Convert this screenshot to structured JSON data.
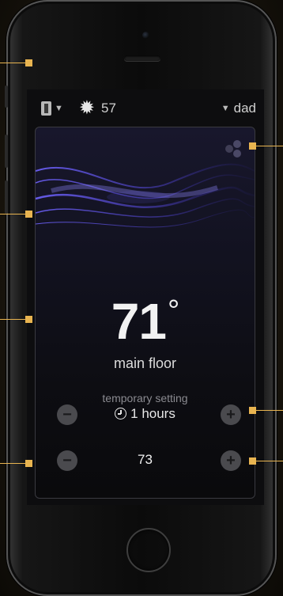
{
  "status_bar": {
    "building_icon": "building-icon",
    "weather_icon": "sun-icon",
    "outdoor_temp": "57",
    "user": "dad"
  },
  "thermostat": {
    "temperature": "71",
    "degree_symbol": "°",
    "zone": "main floor",
    "mode_label": "temporary setting",
    "duration": "1 hours",
    "setpoint": "73"
  },
  "controls": {
    "minus_symbol": "−",
    "plus_symbol": "+"
  },
  "colors": {
    "annotation": "#e8b450",
    "screen": "#0d0d0f",
    "wave": "#5a4fd8"
  }
}
